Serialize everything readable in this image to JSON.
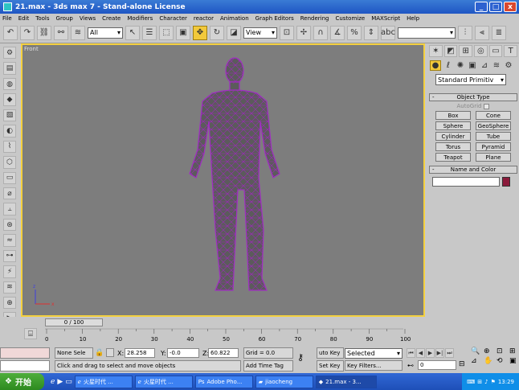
{
  "title": {
    "text": "21.max - 3ds max 7 - Stand-alone License",
    "min": "_",
    "max": "□",
    "close": "x"
  },
  "menu": [
    "File",
    "Edit",
    "Tools",
    "Group",
    "Views",
    "Create",
    "Modifiers",
    "Character",
    "reactor",
    "Animation",
    "Graph Editors",
    "Rendering",
    "Customize",
    "MAXScript",
    "Help"
  ],
  "toolbar": {
    "selection_filter": "All",
    "coord_system": "View"
  },
  "viewport": {
    "label": "Front",
    "axis_z": "z",
    "axis_x": "x"
  },
  "cmd": {
    "dropdown": "Standard Primitiv",
    "object_type_header": "Object Type",
    "autogrid": "AutoGrid",
    "buttons": [
      "Box",
      "Cone",
      "Sphere",
      "GeoSphere",
      "Cylinder",
      "Tube",
      "Torus",
      "Pyramid",
      "Teapot",
      "Plane"
    ],
    "name_color_header": "Name and Color",
    "swatch_color": "#8b1a3b"
  },
  "timeline": {
    "slider": "0 / 100",
    "ticks": [
      "0",
      "10",
      "20",
      "30",
      "40",
      "50",
      "60",
      "70",
      "80",
      "90",
      "100"
    ]
  },
  "status": {
    "selection": "None Sele",
    "x_label": "X:",
    "x_val": "28.258",
    "y_label": "Y:",
    "y_val": "-0.0",
    "z_label": "Z:",
    "z_val": "60.822",
    "grid": "Grid = 0.0",
    "prompt": "Click and drag to select and move objects",
    "add_time_tag": "Add Time Tag",
    "auto_key": "uto Key",
    "set_key": "Set Key",
    "selected": "Selected",
    "key_filters": "Key Filters...",
    "frame": "0"
  },
  "taskbar": {
    "start": "开始",
    "tasks": [
      "火星时代 ...",
      "火星时代 ...",
      "Adobe Pho...",
      "jiaocheng",
      "21.max - 3..."
    ],
    "time": "13:29"
  }
}
